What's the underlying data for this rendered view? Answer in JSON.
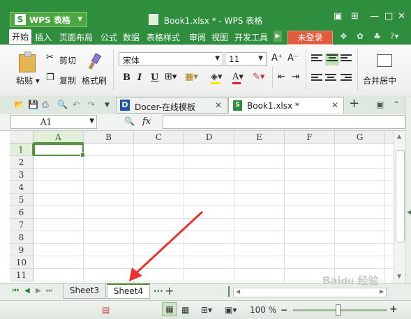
{
  "app": {
    "menu_button": "WPS 表格",
    "doc_title": "Book1.xlsx * - WPS 表格"
  },
  "menu": {
    "items": [
      "开始",
      "插入",
      "页面布局",
      "公式",
      "数据",
      "表格样式",
      "审阅",
      "视图",
      "开发工具"
    ],
    "login": "未登录"
  },
  "ribbon": {
    "paste": "粘贴",
    "cut": "剪切",
    "copy": "复制",
    "format_painter": "格式刷",
    "font_name": "宋体",
    "font_size": "11",
    "bold": "B",
    "italic": "I",
    "underline": "U",
    "merge_center": "合并居中"
  },
  "tabs": {
    "docer": "Docer-在线模板",
    "book": "Book1.xlsx *"
  },
  "formula": {
    "name_box": "A1",
    "fx": "fx",
    "value": ""
  },
  "grid": {
    "columns": [
      "A",
      "B",
      "C",
      "D",
      "E",
      "F",
      "G"
    ],
    "rows": [
      "1",
      "2",
      "3",
      "4",
      "5",
      "6",
      "7",
      "8",
      "9",
      "10",
      "11"
    ],
    "selected_cell": "A1"
  },
  "sheets": {
    "tabs": [
      "Sheet3",
      "Sheet4"
    ],
    "active": "Sheet4",
    "more": "···",
    "add": "+"
  },
  "status": {
    "zoom": "100 %"
  },
  "icons": {
    "annotation_arrow_color": "#e8322b",
    "accent": "#2f8d3e"
  }
}
